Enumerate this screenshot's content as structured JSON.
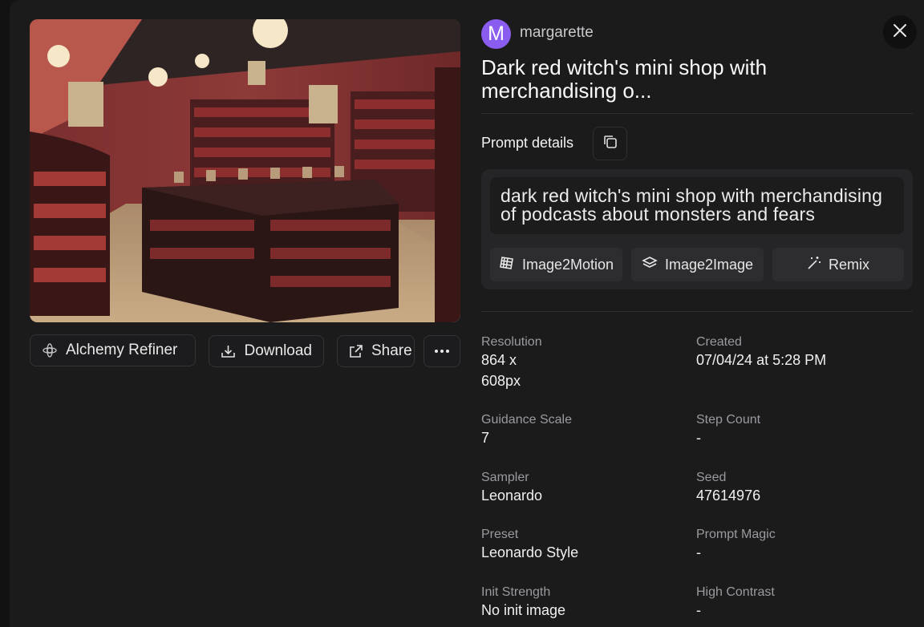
{
  "user": {
    "initial": "M",
    "name": "margarette"
  },
  "title": "Dark red witch's mini shop with merchandising o...",
  "prompt": {
    "label": "Prompt details",
    "text": "dark red witch's mini shop with merchandising of podcasts about monsters and fears",
    "actions": [
      "Image2Motion",
      "Image2Image",
      "Remix"
    ]
  },
  "actions": {
    "alchemy": "Alchemy Refiner",
    "download": "Download",
    "share": "Share"
  },
  "details": {
    "resolution_label": "Resolution",
    "resolution_line1": "864 x",
    "resolution_line2": "608px",
    "created_label": "Created",
    "created_value": "07/04/24 at 5:28 PM",
    "guidance_label": "Guidance Scale",
    "guidance_value": "7",
    "step_label": "Step Count",
    "step_value": "-",
    "sampler_label": "Sampler",
    "sampler_value": "Leonardo",
    "seed_label": "Seed",
    "seed_value": "47614976",
    "preset_label": "Preset",
    "preset_value": "Leonardo Style",
    "magic_label": "Prompt Magic",
    "magic_value": "-",
    "init_label": "Init Strength",
    "init_value": "No init image",
    "contrast_label": "High Contrast",
    "contrast_value": "-"
  },
  "colors": {
    "avatar": "#8a5cf0",
    "background": "#1b1b1c"
  },
  "icons": [
    "alchemy-icon",
    "download-icon",
    "share-icon",
    "more-icon",
    "close-icon",
    "copy-icon",
    "motion-icon",
    "layers-icon",
    "remix-wand-icon"
  ]
}
